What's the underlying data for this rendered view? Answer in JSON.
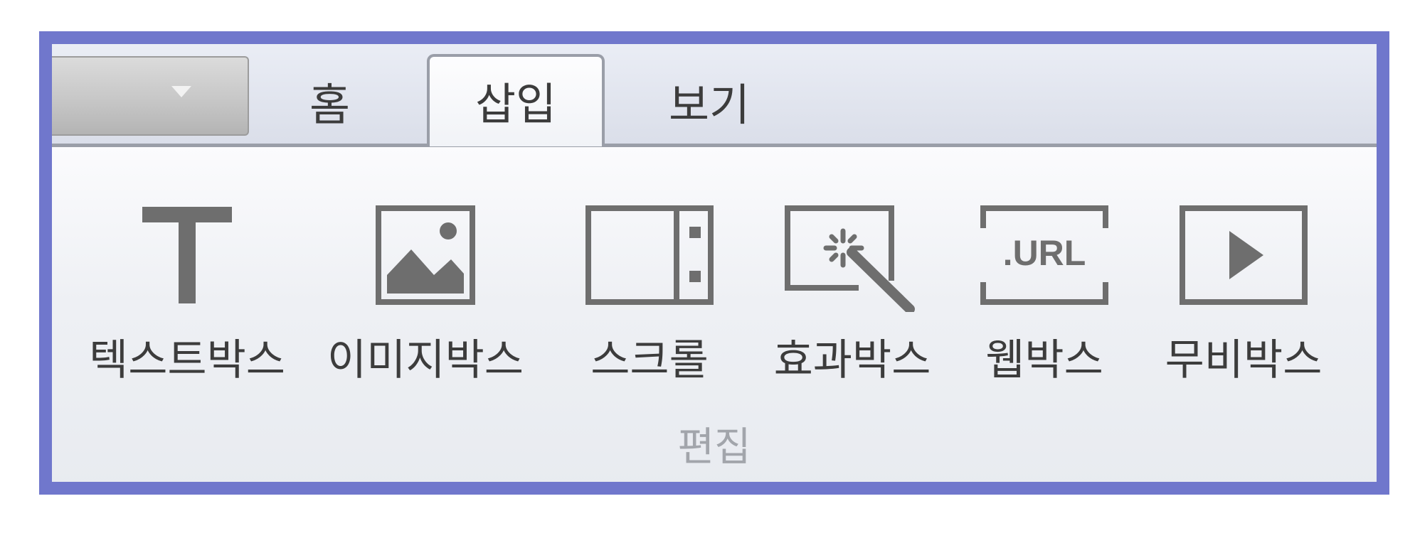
{
  "app_menu": {
    "icon": "chevron-down-icon"
  },
  "tabs": [
    {
      "label": "홈",
      "active": false
    },
    {
      "label": "삽입",
      "active": true
    },
    {
      "label": "보기",
      "active": false
    }
  ],
  "ribbon": {
    "group_label": "편집",
    "buttons": [
      {
        "label": "텍스트박스",
        "icon": "text-icon"
      },
      {
        "label": "이미지박스",
        "icon": "image-icon"
      },
      {
        "label": "스크롤",
        "icon": "scroll-icon"
      },
      {
        "label": "효과박스",
        "icon": "magic-wand-icon"
      },
      {
        "label": "웹박스",
        "icon": "url-icon",
        "icon_text": ".URL"
      },
      {
        "label": "무비박스",
        "icon": "play-icon"
      }
    ]
  },
  "colors": {
    "frame": "#7077cc",
    "icon": "#6e6e6e",
    "text": "#3c3c3c",
    "group_label": "#a2a5ab"
  }
}
